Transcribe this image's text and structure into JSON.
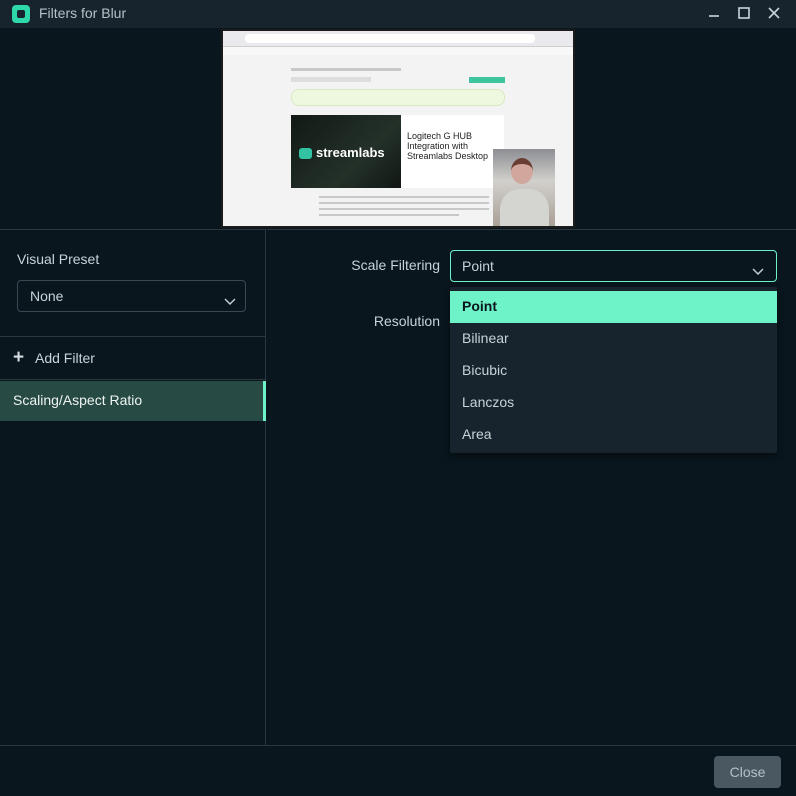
{
  "window": {
    "title": "Filters for Blur"
  },
  "preview": {
    "article_title": "Logitech G HUB Integration with Streamlabs Desktop",
    "logo_text": "streamlabs"
  },
  "left_panel": {
    "visual_preset_label": "Visual Preset",
    "visual_preset_value": "None",
    "add_filter_label": "Add Filter",
    "filters": [
      "Scaling/Aspect Ratio"
    ]
  },
  "right_panel": {
    "scale_filtering_label": "Scale Filtering",
    "scale_filtering_value": "Point",
    "resolution_label": "Resolution",
    "options": [
      "Point",
      "Bilinear",
      "Bicubic",
      "Lanczos",
      "Area"
    ],
    "selected_option": "Point"
  },
  "footer": {
    "close_label": "Close"
  },
  "colors": {
    "accent": "#6ef3c8",
    "background": "#09161d",
    "panel": "#17242d",
    "selected_filter": "#284a44"
  }
}
